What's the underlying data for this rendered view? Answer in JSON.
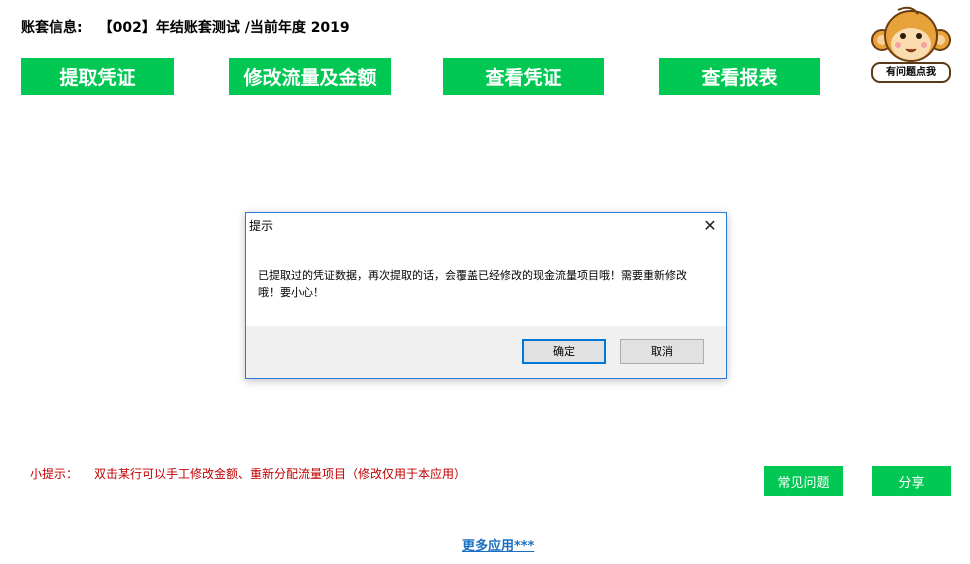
{
  "header": {
    "account_label": "账套信息:",
    "account_value": "【002】年结账套测试 /当前年度 2019"
  },
  "actions": [
    {
      "label": "提取凭证"
    },
    {
      "label": "修改流量及金额"
    },
    {
      "label": "查看凭证"
    },
    {
      "label": "查看报表"
    }
  ],
  "help": {
    "label": "有问题点我",
    "icon": "monkey-mascot-icon"
  },
  "dialog": {
    "title": "提示",
    "close_glyph": "✕",
    "message": "已提取过的凭证数据，再次提取的话，会覆盖已经修改的现金流量项目哦！需要重新修改哦！要小心！",
    "ok_label": "确定",
    "cancel_label": "取消"
  },
  "tip": {
    "label": "小提示：",
    "text": "双击某行可以手工修改金额、重新分配流量项目（修改仅用于本应用）"
  },
  "bottom_buttons": {
    "faq_label": "常见问题",
    "share_label": "分享"
  },
  "more_link": "更多应用***",
  "colors": {
    "accent_green": "#00c853",
    "tip_red": "#c00000",
    "link_blue": "#1a6fc2",
    "dialog_border": "#2b79d8"
  }
}
